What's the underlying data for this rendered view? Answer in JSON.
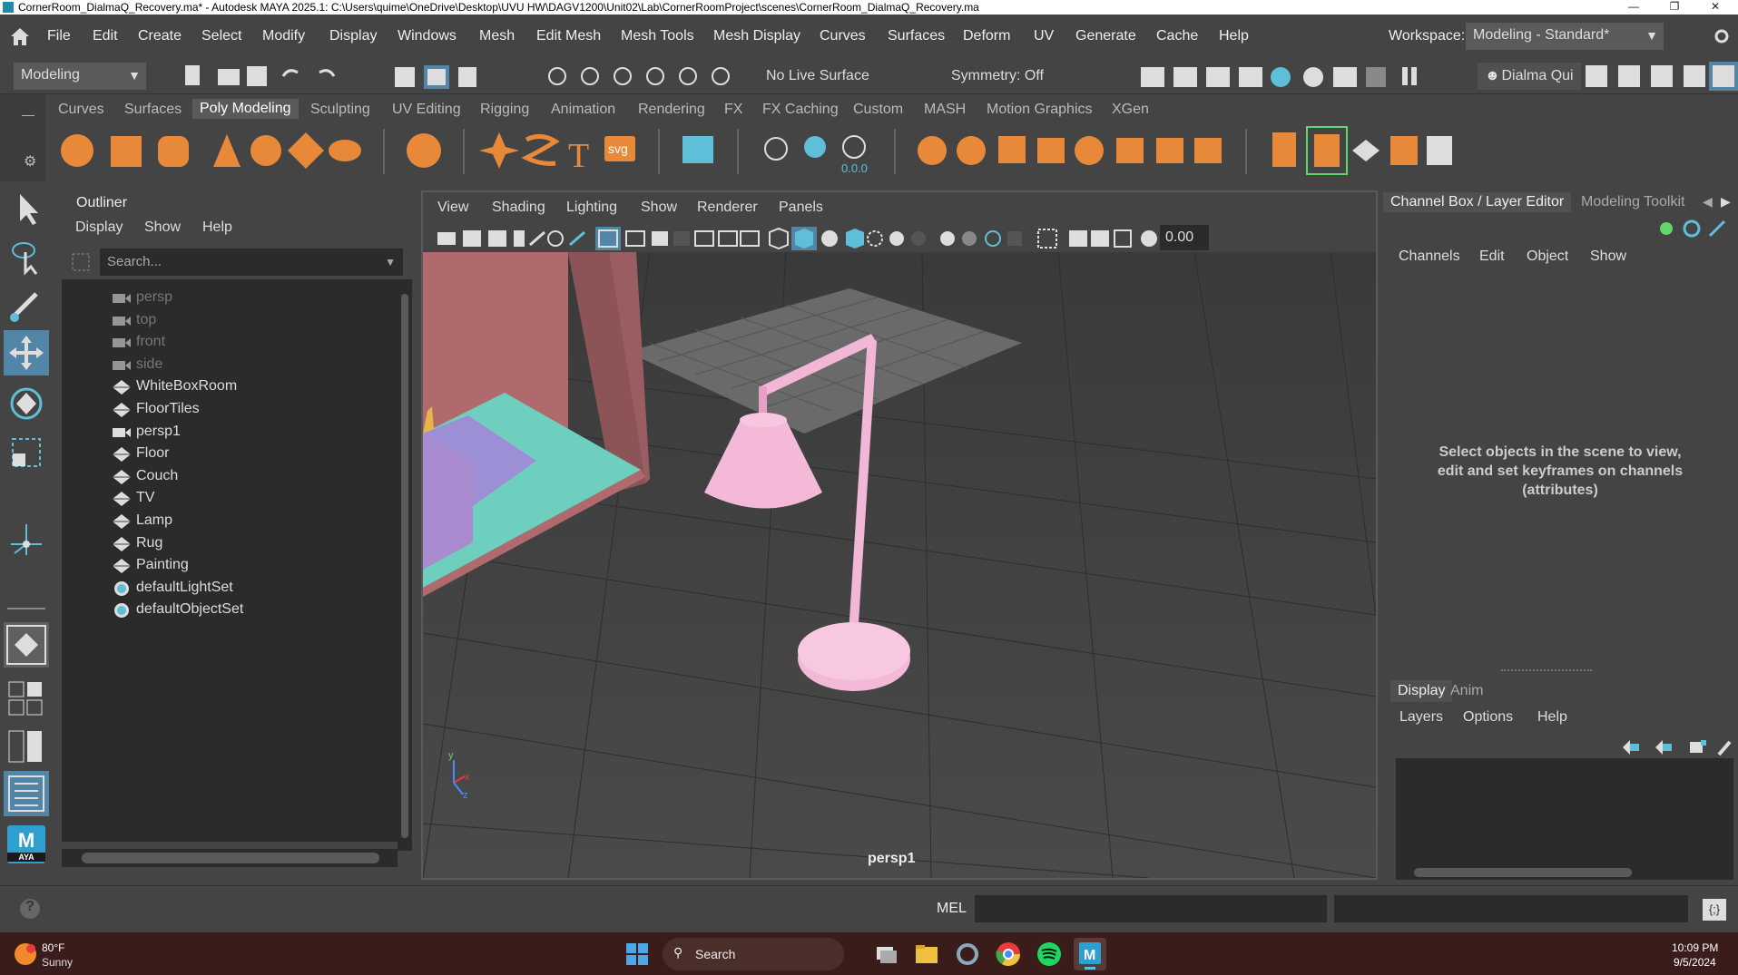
{
  "window": {
    "title": "CornerRoom_DialmaQ_Recovery.ma* - Autodesk MAYA 2025.1: C:\\Users\\quime\\OneDrive\\Desktop\\UVU HW\\DAGV1200\\Unit02\\Lab\\CornerRoomProject\\scenes\\CornerRoom_DialmaQ_Recovery.ma"
  },
  "menubar": {
    "items": [
      "File",
      "Edit",
      "Create",
      "Select",
      "Modify",
      "Display",
      "Windows",
      "Mesh",
      "Edit Mesh",
      "Mesh Tools",
      "Mesh Display",
      "Curves",
      "Surfaces",
      "Deform",
      "UV",
      "Generate",
      "Cache",
      "Help"
    ],
    "workspace_label": "Workspace:",
    "workspace_value": "Modeling - Standard*"
  },
  "statusline": {
    "mode": "Modeling",
    "live_surface": "No Live Surface",
    "symmetry": "Symmetry: Off",
    "user": "Dialma Qui"
  },
  "shelf": {
    "tabs": [
      "Curves",
      "Surfaces",
      "Poly Modeling",
      "Sculpting",
      "UV Editing",
      "Rigging",
      "Animation",
      "Rendering",
      "FX",
      "FX Caching",
      "Custom",
      "MASH",
      "Motion Graphics",
      "XGen"
    ],
    "active_tab": "Poly Modeling",
    "value_readout": "0.0.0"
  },
  "outliner": {
    "title": "Outliner",
    "menu": [
      "Display",
      "Show",
      "Help"
    ],
    "search_placeholder": "Search...",
    "items": [
      {
        "label": "persp",
        "type": "camera",
        "dim": true
      },
      {
        "label": "top",
        "type": "camera",
        "dim": true
      },
      {
        "label": "front",
        "type": "camera",
        "dim": true
      },
      {
        "label": "side",
        "type": "camera",
        "dim": true
      },
      {
        "label": "WhiteBoxRoom",
        "type": "mesh",
        "dim": false
      },
      {
        "label": "FloorTiles",
        "type": "mesh",
        "dim": false
      },
      {
        "label": "persp1",
        "type": "camera",
        "dim": false
      },
      {
        "label": "Floor",
        "type": "mesh",
        "dim": false
      },
      {
        "label": "Couch",
        "type": "mesh",
        "dim": false
      },
      {
        "label": "TV",
        "type": "mesh",
        "dim": false
      },
      {
        "label": "Lamp",
        "type": "mesh",
        "dim": false
      },
      {
        "label": "Rug",
        "type": "mesh",
        "dim": false
      },
      {
        "label": "Painting",
        "type": "mesh",
        "dim": false
      },
      {
        "label": "defaultLightSet",
        "type": "set",
        "dim": false
      },
      {
        "label": "defaultObjectSet",
        "type": "set",
        "dim": false
      }
    ]
  },
  "viewport": {
    "menu": [
      "View",
      "Shading",
      "Lighting",
      "Show",
      "Renderer",
      "Panels"
    ],
    "value_field": "0.00",
    "camera_label": "persp1"
  },
  "channelbox": {
    "tabs": [
      "Channel Box / Layer Editor",
      "Modeling Toolkit"
    ],
    "menu": [
      "Channels",
      "Edit",
      "Object",
      "Show"
    ],
    "message_lines": [
      "Select objects in the scene to view,",
      "edit and set keyframes on channels",
      "(attributes)"
    ],
    "layer_tabs": [
      "Display",
      "Anim"
    ],
    "layer_menu": [
      "Layers",
      "Options",
      "Help"
    ]
  },
  "cmdline": {
    "label": "MEL"
  },
  "taskbar": {
    "weather_temp": "80°F",
    "weather_desc": "Sunny",
    "search_label": "Search",
    "time": "10:09 PM",
    "date": "9/5/2024"
  }
}
